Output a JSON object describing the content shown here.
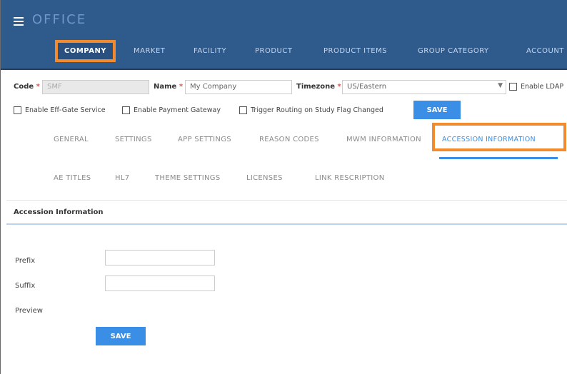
{
  "app": {
    "title": "OFFICE"
  },
  "nav": [
    {
      "label": "COMPANY",
      "active": true
    },
    {
      "label": "MARKET"
    },
    {
      "label": "FACILITY"
    },
    {
      "label": "PRODUCT"
    },
    {
      "label": "PRODUCT ITEMS"
    },
    {
      "label": "GROUP CATEGORY"
    },
    {
      "label": "ACCOUNT"
    }
  ],
  "company_form": {
    "code_label": "Code",
    "code_value": "SMF",
    "name_label": "Name",
    "name_value": "My Company",
    "timezone_label": "Timezone",
    "timezone_value": "US/Eastern",
    "enable_label": "Enable LDAP",
    "required_mark": "*"
  },
  "checkboxes": [
    {
      "label": "Enable Eff-Gate Service"
    },
    {
      "label": "Enable Payment Gateway"
    },
    {
      "label": "Trigger Routing on Study Flag Changed"
    }
  ],
  "top_save": "SAVE",
  "tabs_row1": [
    {
      "label": "GENERAL"
    },
    {
      "label": "SETTINGS"
    },
    {
      "label": "APP SETTINGS"
    },
    {
      "label": "REASON CODES"
    },
    {
      "label": "MWM INFORMATION"
    },
    {
      "label": "ACCESSION INFORMATION",
      "active": true
    }
  ],
  "tabs_row2": [
    {
      "label": "AE TITLES"
    },
    {
      "label": "HL7"
    },
    {
      "label": "THEME SETTINGS"
    },
    {
      "label": "LICENSES"
    },
    {
      "label": "LINK RESCRIPTION"
    }
  ],
  "section": {
    "title": "Accession Information"
  },
  "accession_form": {
    "prefix_label": "Prefix",
    "suffix_label": "Suffix",
    "preview_label": "Preview",
    "save_label": "SAVE"
  },
  "colors": {
    "header": "#2f5a8c",
    "accent": "#3a8ee6",
    "highlight": "#f28a2e"
  }
}
